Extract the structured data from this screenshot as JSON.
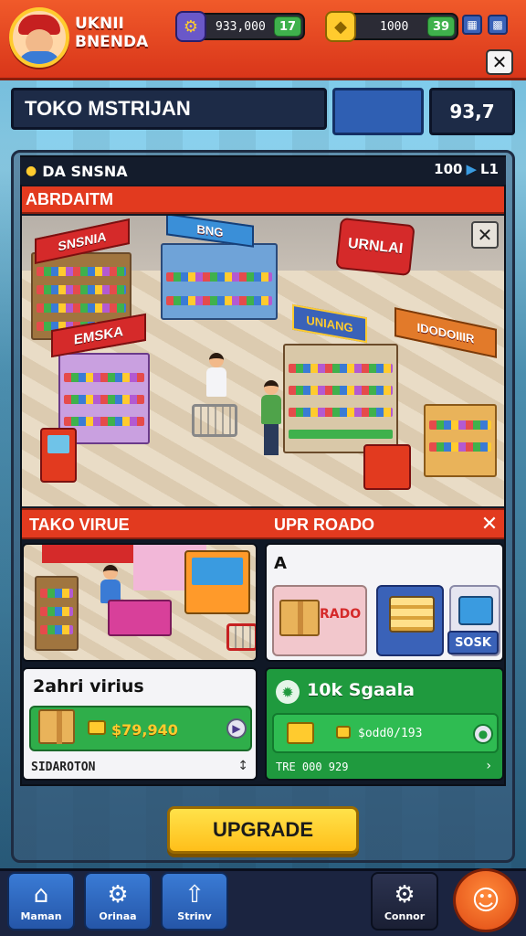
{
  "header": {
    "player_name": "UKNII BNENDA",
    "resource_1_value": "933,000",
    "resource_1_plus": "17",
    "resource_2_value": "1000",
    "resource_2_plus": "39",
    "close": "✕"
  },
  "shop": {
    "title": "TOKO MSTRIJAN",
    "value": "93,7"
  },
  "panel": {
    "header_label": "DA SNSNA",
    "header_count": "100",
    "header_suffix": "L1",
    "strip_label": "ABRDAITM",
    "close": "✕"
  },
  "scene": {
    "signs": [
      "SNSNIA",
      "BNG",
      "URNLAI",
      "EMSKA",
      "UNIANG",
      "IDODOIIIR"
    ]
  },
  "section": {
    "left_label": "TAKO VIRUE",
    "right_label": "UPR ROADO",
    "close": "✕"
  },
  "upgrade_card": {
    "title": "A",
    "red_label": "RADO",
    "button_label": "SOSK"
  },
  "white_card": {
    "title": "2ahri virius",
    "value": "$79,940",
    "footer": "SIDAROTON",
    "footer_icon": "↕"
  },
  "green_card": {
    "title": "10k Sgaala",
    "value": "$odd0/193",
    "footer": "TRE 000 929",
    "footer_icon": "›"
  },
  "upgrade_button": "UPGRADE",
  "nav": {
    "items": [
      {
        "label": "Maman",
        "icon": "home-icon"
      },
      {
        "label": "Orinaa",
        "icon": "gear-icon"
      },
      {
        "label": "Strinv",
        "icon": "upgrade-icon"
      },
      {
        "label": "Connor",
        "icon": "settings-icon"
      },
      {
        "label": "",
        "icon": "profile-icon"
      }
    ]
  }
}
